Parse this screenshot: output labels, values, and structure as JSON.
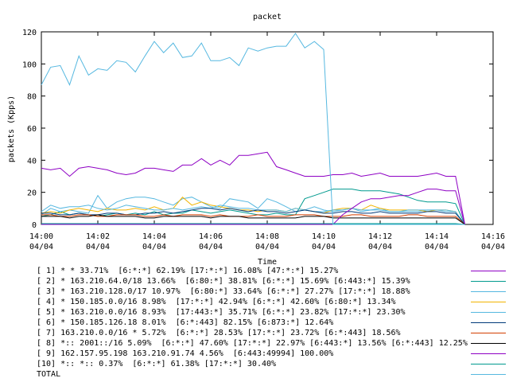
{
  "chart_data": {
    "type": "line",
    "title": "packet",
    "xlabel": "Time",
    "ylabel": "packets (Kpps)",
    "ylim": [
      0,
      120
    ],
    "yticks": [
      0,
      20,
      40,
      60,
      80,
      100,
      120
    ],
    "xlim": [
      0,
      16
    ],
    "xticks": [
      {
        "value": 0,
        "time": "14:00",
        "date": "04/04"
      },
      {
        "value": 2,
        "time": "14:02",
        "date": "04/04"
      },
      {
        "value": 4,
        "time": "14:04",
        "date": "04/04"
      },
      {
        "value": 6,
        "time": "14:06",
        "date": "04/04"
      },
      {
        "value": 8,
        "time": "14:08",
        "date": "04/04"
      },
      {
        "value": 10,
        "time": "14:10",
        "date": "04/04"
      },
      {
        "value": 12,
        "time": "14:12",
        "date": "04/04"
      },
      {
        "value": 14,
        "time": "14:14",
        "date": "04/04"
      },
      {
        "value": 16,
        "time": "14:16",
        "date": "04/04"
      }
    ],
    "grid": false,
    "legend_position": "bottom",
    "x": [
      0,
      0.33,
      0.67,
      1,
      1.33,
      1.67,
      2,
      2.33,
      2.67,
      3,
      3.33,
      3.67,
      4,
      4.33,
      4.67,
      5,
      5.33,
      5.67,
      6,
      6.33,
      6.67,
      7,
      7.33,
      7.67,
      8,
      8.33,
      8.67,
      9,
      9.33,
      9.67,
      10,
      10.33,
      10.67,
      11,
      11.33,
      11.67,
      12,
      12.33,
      12.67,
      13,
      13.33,
      13.67,
      14,
      14.33,
      14.67,
      15
    ],
    "series": [
      {
        "name": "[ 1] * * 33.71%  [6:*:*] 62.19% [17:*:*] 16.08% [47:*:*] 15.27%",
        "color": "#8e00c4",
        "values": [
          35,
          34,
          35,
          30,
          35,
          36,
          35,
          34,
          32,
          31,
          32,
          35,
          35,
          34,
          33,
          37,
          37,
          41,
          37,
          40,
          37,
          43,
          43,
          44,
          45,
          36,
          34,
          32,
          30,
          30,
          30,
          31,
          31,
          32,
          30,
          31,
          32,
          30,
          30,
          30,
          30,
          31,
          32,
          30,
          30,
          0
        ]
      },
      {
        "name": "[ 2] * 163.210.64.0/18 13.66%  [6:80:*] 38.81% [6:*:*] 15.69% [6:443:*] 15.39%",
        "color": "#009a8e",
        "values": [
          5,
          6,
          8,
          6,
          7,
          6,
          5,
          6,
          7,
          6,
          7,
          6,
          8,
          6,
          7,
          7,
          9,
          8,
          7,
          8,
          9,
          8,
          7,
          6,
          6,
          7,
          6,
          6,
          16,
          18,
          20,
          22,
          22,
          22,
          21,
          21,
          21,
          20,
          19,
          17,
          15,
          14,
          14,
          14,
          13,
          0
        ]
      },
      {
        "name": "[ 3] * 163.210.128.0/17 10.97%  [6:80:*] 33.64% [6:*:*] 27.27% [17:*:*] 18.88%",
        "color": "#56b8e0",
        "values": [
          6,
          10,
          8,
          9,
          8,
          7,
          18,
          10,
          14,
          16,
          17,
          17,
          16,
          14,
          12,
          16,
          17,
          14,
          11,
          10,
          16,
          15,
          14,
          10,
          16,
          14,
          11,
          8,
          9,
          11,
          9,
          8,
          9,
          10,
          8,
          9,
          10,
          8,
          8,
          8,
          8,
          9,
          9,
          8,
          8,
          0
        ]
      },
      {
        "name": "[ 4] * 150.185.0.0/16 8.98%  [17:*:*] 42.94% [6:*:*] 42.60% [6:80:*] 13.34%",
        "color": "#f2b400",
        "values": [
          7,
          8,
          7,
          9,
          10,
          9,
          8,
          10,
          9,
          9,
          10,
          9,
          11,
          9,
          10,
          17,
          12,
          14,
          12,
          11,
          10,
          9,
          9,
          8,
          9,
          9,
          8,
          10,
          9,
          8,
          7,
          9,
          10,
          10,
          9,
          12,
          10,
          9,
          9,
          9,
          9,
          8,
          9,
          9,
          8,
          0
        ]
      },
      {
        "name": "[ 5] * 163.210.0.0/16 8.93%  [17:443:*] 35.71% [6:*:*] 23.82% [17:*:*] 23.30%",
        "color": "#56b8e0",
        "values": [
          8,
          12,
          10,
          11,
          11,
          12,
          10,
          9,
          10,
          12,
          11,
          10,
          9,
          9,
          10,
          9,
          10,
          11,
          10,
          12,
          11,
          10,
          10,
          9,
          9,
          9,
          8,
          10,
          9,
          8,
          8,
          9,
          9,
          10,
          9,
          9,
          9,
          8,
          8,
          9,
          9,
          9,
          9,
          9,
          8,
          0
        ]
      },
      {
        "name": "[ 6] * 150.185.126.18 8.01%  [6:*:443] 82.15% [6:873:*] 12.64%",
        "color": "#003a7a",
        "values": [
          7,
          7,
          6,
          6,
          7,
          6,
          6,
          7,
          7,
          6,
          6,
          7,
          7,
          8,
          7,
          8,
          9,
          10,
          10,
          9,
          10,
          9,
          8,
          9,
          8,
          8,
          7,
          8,
          9,
          8,
          7,
          7,
          8,
          8,
          7,
          7,
          8,
          7,
          7,
          7,
          7,
          8,
          8,
          7,
          7,
          0
        ]
      },
      {
        "name": "[ 7] 163.210.0.0/16 * 5.72%  [6:*:*] 28.53% [17:*:*] 23.72% [6:*:443] 18.56%",
        "color": "#d43f00",
        "values": [
          6,
          6,
          5,
          5,
          6,
          6,
          5,
          5,
          6,
          6,
          6,
          5,
          5,
          6,
          5,
          6,
          6,
          6,
          5,
          6,
          5,
          5,
          5,
          6,
          5,
          5,
          5,
          6,
          6,
          6,
          5,
          5,
          5,
          6,
          6,
          5,
          5,
          5,
          5,
          6,
          6,
          5,
          5,
          5,
          5,
          0
        ]
      },
      {
        "name": "[ 8] *:: 2001::/16 5.09%  [6:*:*] 47.60% [17:*:*] 22.97% [6:443:*] 13.56% [6:*:443] 12.25%",
        "color": "#000000",
        "values": [
          5,
          5,
          5,
          4,
          5,
          5,
          6,
          5,
          5,
          5,
          5,
          4,
          4,
          5,
          5,
          5,
          5,
          5,
          4,
          5,
          5,
          5,
          4,
          4,
          4,
          4,
          4,
          4,
          5,
          5,
          5,
          4,
          4,
          4,
          4,
          4,
          4,
          4,
          4,
          4,
          4,
          4,
          4,
          4,
          4,
          0
        ]
      },
      {
        "name": "[ 9] 162.157.95.198 163.210.91.74 4.56%  [6:443:49994] 100.00%",
        "color": "#8e00c4",
        "values": [
          0,
          0,
          0,
          0,
          0,
          0,
          0,
          0,
          0,
          0,
          0,
          0,
          0,
          0,
          0,
          0,
          0,
          0,
          0,
          0,
          0,
          0,
          0,
          0,
          0,
          0,
          0,
          0,
          0,
          0,
          0,
          0,
          6,
          10,
          14,
          16,
          16,
          17,
          18,
          18,
          20,
          22,
          22,
          21,
          21,
          0
        ]
      },
      {
        "name": "[10] *:: *:: 0.37%  [6:*:*] 61.38% [17:*:*] 30.40%",
        "color": "#009a8e",
        "values": [
          0.5,
          0.5,
          0.5,
          0.5,
          0.5,
          0.5,
          0.5,
          0.5,
          0.5,
          0.5,
          0.5,
          0.5,
          0.5,
          0.5,
          0.5,
          0.5,
          0.5,
          0.5,
          0.5,
          0.5,
          0.5,
          0.5,
          0.5,
          0.5,
          0.5,
          0.5,
          0.5,
          0.5,
          0.5,
          0.5,
          0.5,
          0.5,
          0.5,
          0.5,
          0.5,
          0.5,
          0.5,
          0.5,
          0.5,
          0.5,
          0.5,
          0.5,
          0.5,
          0.5,
          0.5,
          0
        ]
      },
      {
        "name": "TOTAL",
        "color": "#56b8e0",
        "values": [
          87,
          98,
          99,
          87,
          105,
          93,
          97,
          96,
          102,
          101,
          95,
          105,
          114,
          107,
          113,
          104,
          105,
          113,
          102,
          102,
          104,
          99,
          110,
          108,
          110,
          111,
          111,
          119,
          110,
          114,
          109,
          0,
          0,
          0,
          0,
          0,
          0,
          0,
          0,
          0,
          0,
          0,
          0,
          0,
          0,
          0
        ]
      }
    ]
  }
}
